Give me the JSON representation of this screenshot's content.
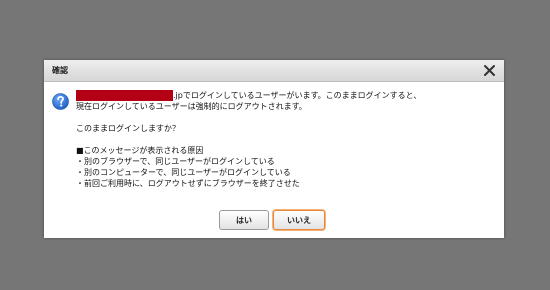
{
  "dialog": {
    "title": "確認",
    "close_icon": "close-icon",
    "question_icon": "question-icon",
    "message": {
      "line1_suffix": ".jpでログインしているユーザーがいます。このままログインすると、",
      "line2": "現在ログインしているユーザーは強制的にログアウトされます。",
      "prompt": "このままログインしますか？",
      "reasons_heading": "■このメッセージが表示される原因",
      "reasons": [
        "・別のブラウザーで、同じユーザーがログインしている",
        "・別のコンピューターで、同じユーザーがログインしている",
        "・前回ご利用時に、ログアウトせずにブラウザーを終了させた"
      ]
    },
    "buttons": {
      "yes_label": "はい",
      "no_label": "いいえ"
    }
  },
  "colors": {
    "overlay": "#767676",
    "redaction": "#b40015",
    "focus_border": "#e8883a",
    "icon_blue": "#1f62c9"
  }
}
